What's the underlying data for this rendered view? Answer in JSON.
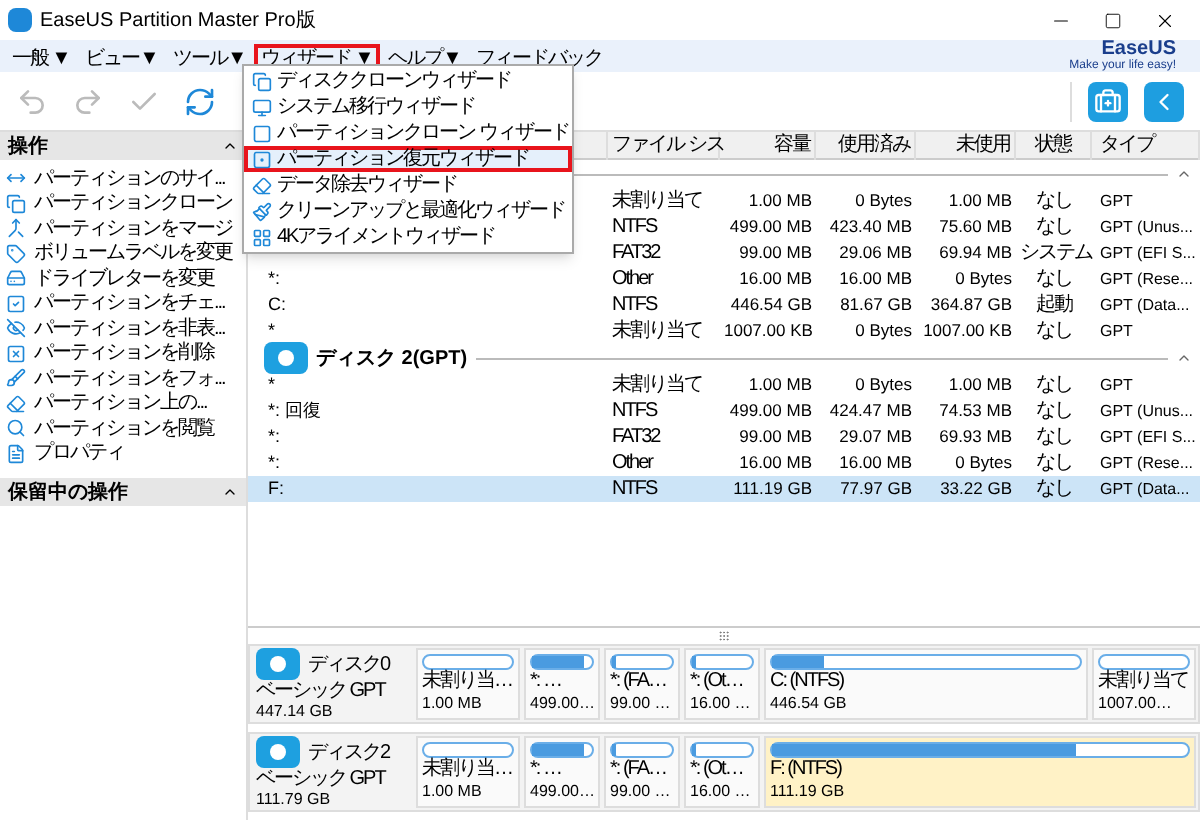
{
  "window": {
    "title": "EaseUS Partition Master Pro版"
  },
  "menu": [
    {
      "label": "一般 ▼",
      "selected": false
    },
    {
      "label": "ビュー▼",
      "selected": false
    },
    {
      "label": "ツール▼",
      "selected": false
    },
    {
      "label": "ウィザード ▼",
      "selected": true
    },
    {
      "label": "ヘルプ▼",
      "selected": false
    },
    {
      "label": "フィードバック",
      "selected": false
    }
  ],
  "logo": {
    "name": "EaseUS",
    "tagline": "Make your life easy!"
  },
  "wizard_menu": [
    {
      "label": "ディスククローンウィザード",
      "selected": false
    },
    {
      "label": "システム移行ウィザード",
      "selected": false
    },
    {
      "label": "パーティションクローン ウィザード",
      "selected": false
    },
    {
      "label": "パーティション復元ウィザード",
      "selected": true
    },
    {
      "label": "データ除去ウィザード",
      "selected": false
    },
    {
      "label": "クリーンアップと最適化ウィザード",
      "selected": false
    },
    {
      "label": "4Kアライメントウィザード",
      "selected": false
    }
  ],
  "sidebar": {
    "title": "操作",
    "items": [
      "パーティションのサイ...",
      "パーティションクローン",
      "パーティションをマージ",
      "ボリュームラベルを変更",
      "ドライブレターを変更",
      "パーティションをチェ...",
      "パーティションを非表...",
      "パーティションを削除",
      "パーティションをフォ...",
      "パーティション上の...",
      "パーティションを閲覧",
      "プロパティ"
    ],
    "pending_title": "保留中の操作"
  },
  "table": {
    "columns": [
      "ファイル シス",
      "容量",
      "使用済み",
      "未使用",
      "状態",
      "タイプ"
    ],
    "groups": [
      {
        "rows": [
          {
            "fs": "未割り当て",
            "capacity": "1.00 MB",
            "used": "0 Bytes",
            "unused": "1.00 MB",
            "status": "なし",
            "type": "GPT",
            "selected": false
          },
          {
            "fs": "NTFS",
            "capacity": "499.00 MB",
            "used": "423.40 MB",
            "unused": "75.60 MB",
            "status": "なし",
            "type": "GPT (Unus...",
            "selected": false
          },
          {
            "fs": "FAT32",
            "capacity": "99.00 MB",
            "used": "29.06 MB",
            "unused": "69.94 MB",
            "status": "システム",
            "type": "GPT (EFI S...",
            "selected": false
          },
          {
            "name": "*:",
            "fs": "Other",
            "capacity": "16.00 MB",
            "used": "16.00 MB",
            "unused": "0 Bytes",
            "status": "なし",
            "type": "GPT (Rese...",
            "selected": false
          },
          {
            "name": "C:",
            "fs": "NTFS",
            "capacity": "446.54 GB",
            "used": "81.67 GB",
            "unused": "364.87 GB",
            "status": "起動",
            "type": "GPT (Data...",
            "selected": false
          },
          {
            "name": "*",
            "fs": "未割り当て",
            "capacity": "1007.00 KB",
            "used": "0 Bytes",
            "unused": "1007.00 KB",
            "status": "なし",
            "type": "GPT",
            "selected": false
          }
        ]
      },
      {
        "title": "ディスク 2(GPT)",
        "rows": [
          {
            "name": "*",
            "fs": "未割り当て",
            "capacity": "1.00 MB",
            "used": "0 Bytes",
            "unused": "1.00 MB",
            "status": "なし",
            "type": "GPT",
            "selected": false
          },
          {
            "name": "*: 回復",
            "fs": "NTFS",
            "capacity": "499.00 MB",
            "used": "424.47 MB",
            "unused": "74.53 MB",
            "status": "なし",
            "type": "GPT (Unus...",
            "selected": false
          },
          {
            "name": "*:",
            "fs": "FAT32",
            "capacity": "99.00 MB",
            "used": "29.07 MB",
            "unused": "69.93 MB",
            "status": "なし",
            "type": "GPT (EFI S...",
            "selected": false
          },
          {
            "name": "*:",
            "fs": "Other",
            "capacity": "16.00 MB",
            "used": "16.00 MB",
            "unused": "0 Bytes",
            "status": "なし",
            "type": "GPT (Rese...",
            "selected": false
          },
          {
            "name": "F:",
            "fs": "NTFS",
            "capacity": "111.19 GB",
            "used": "77.97 GB",
            "unused": "33.22 GB",
            "status": "なし",
            "type": "GPT (Data...",
            "selected": true
          }
        ]
      }
    ]
  },
  "disk_map": [
    {
      "name": "ディスク0",
      "kind": "ベーシック GPT",
      "size": "447.14 GB",
      "partitions": [
        {
          "label": "未割り当…",
          "size": "1.00 MB",
          "selected": false
        },
        {
          "label": "*: …",
          "size": "499.00…",
          "level": 0.85,
          "selected": false
        },
        {
          "label": "*: (FA…",
          "size": "99.00 …",
          "level": 0.05,
          "selected": false
        },
        {
          "label": "*: (Ot…",
          "size": "16.00 …",
          "level": 0.05,
          "selected": false
        },
        {
          "label": "C: (NTFS)",
          "size": "446.54 GB",
          "level": 0.17,
          "selected": false
        },
        {
          "label": "未割り当て",
          "size": "1007.00…",
          "selected": false
        }
      ]
    },
    {
      "name": "ディスク2",
      "kind": "ベーシック GPT",
      "size": "111.79 GB",
      "partitions": [
        {
          "label": "未割り当…",
          "size": "1.00 MB",
          "selected": false
        },
        {
          "label": "*: …",
          "size": "499.00…",
          "level": 0.85,
          "selected": false
        },
        {
          "label": "*: (FA…",
          "size": "99.00 …",
          "level": 0.05,
          "selected": false
        },
        {
          "label": "*: (Ot…",
          "size": "16.00 …",
          "level": 0.05,
          "selected": false
        },
        {
          "label": "F: (NTFS)",
          "size": "111.19 GB",
          "level": 0.73,
          "selected": true
        }
      ]
    }
  ]
}
